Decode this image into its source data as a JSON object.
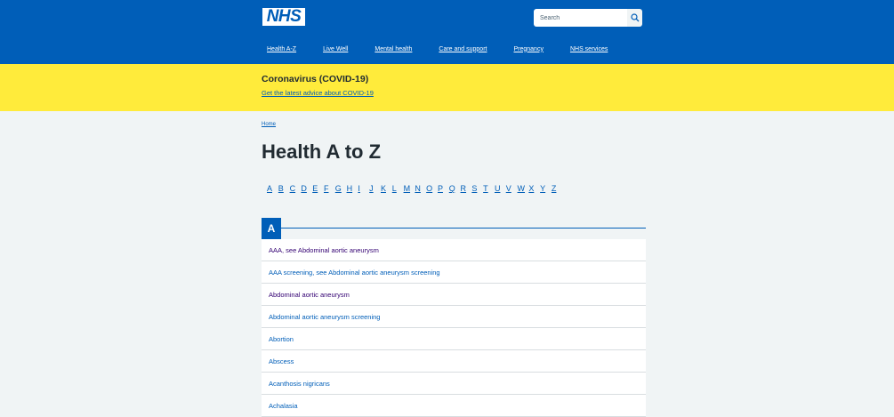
{
  "header": {
    "logo": "NHS",
    "search_placeholder": "Search",
    "nav": [
      "Health A-Z",
      "Live Well",
      "Mental health",
      "Care and support",
      "Pregnancy",
      "NHS services"
    ]
  },
  "banner": {
    "title": "Coronavirus (COVID-19)",
    "link": "Get the latest advice about COVID-19"
  },
  "breadcrumb": "Home",
  "page_title": "Health A to Z",
  "az_letters": [
    "A",
    "B",
    "C",
    "D",
    "E",
    "F",
    "G",
    "H",
    "I",
    "J",
    "K",
    "L",
    "M",
    "N",
    "O",
    "P",
    "Q",
    "R",
    "S",
    "T",
    "U",
    "V",
    "W",
    "X",
    "Y",
    "Z"
  ],
  "section": {
    "letter": "A",
    "items": [
      "AAA, see Abdominal aortic aneurysm",
      "AAA screening, see Abdominal aortic aneurysm screening",
      "Abdominal aortic aneurysm",
      "Abdominal aortic aneurysm screening",
      "Abortion",
      "Abscess",
      "Acanthosis nigricans",
      "Achalasia"
    ]
  },
  "colors": {
    "nhs_blue": "#005eb8",
    "banner_yellow": "#ffeb3b",
    "visited_purple": "#330072",
    "page_background": "#f0f4f5"
  },
  "icons": [
    "search-icon"
  ]
}
